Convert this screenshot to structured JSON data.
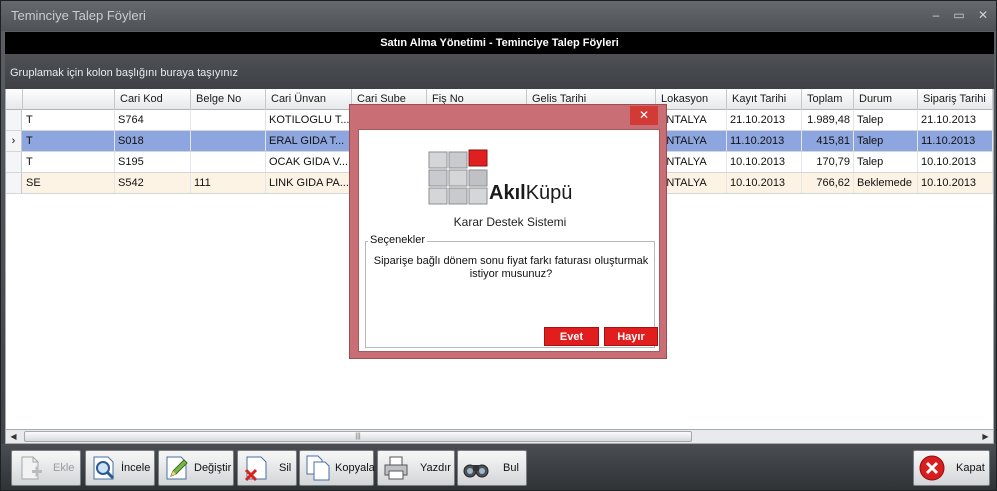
{
  "window": {
    "title": "Teminciye Talep Föyleri",
    "controls": [
      "–",
      "▭",
      "✕"
    ]
  },
  "header": {
    "title": "Satın Alma Yönetimi - Teminciye Talep Föyleri"
  },
  "group_panel": {
    "hint": "Gruplamak için kolon başlığını buraya taşıyınız"
  },
  "grid": {
    "columns": [
      "",
      "Cari Kod",
      "Belge No",
      "Cari Ünvan",
      "Cari Sube",
      "Fiş No",
      "Gelis Tarihi",
      "Lokasyon",
      "Kayıt Tarihi",
      "Toplam",
      "Durum",
      "Sipariş Tarihi"
    ],
    "rows": [
      {
        "indicator": "",
        "type": "T",
        "cari_kod": "S764",
        "belge_no": "",
        "cari_unvan": "KOTILOGLU T...",
        "lokasyon": "ANTALYA",
        "kayit_tarihi": "21.10.2013",
        "toplam": "1.989,48",
        "durum": "Talep",
        "siparis_tarihi": "21.10.2013"
      },
      {
        "indicator": "›",
        "type": "T",
        "cari_kod": "S018",
        "belge_no": "",
        "cari_unvan": "ERAL GIDA T...",
        "lokasyon": "ANTALYA",
        "kayit_tarihi": "11.10.2013",
        "toplam": "415,81",
        "durum": "Talep",
        "siparis_tarihi": "11.10.2013"
      },
      {
        "indicator": "",
        "type": "T",
        "cari_kod": "S195",
        "belge_no": "",
        "cari_unvan": "OCAK GIDA V...",
        "lokasyon": "ANTALYA",
        "kayit_tarihi": "10.10.2013",
        "toplam": "170,79",
        "durum": "Talep",
        "siparis_tarihi": "10.10.2013"
      },
      {
        "indicator": "",
        "type": "SE",
        "cari_kod": "S542",
        "belge_no": "111",
        "cari_unvan": "LINK GIDA PA...",
        "lokasyon": "ANTALYA",
        "kayit_tarihi": "10.10.2013",
        "toplam": "766,62",
        "durum": "Beklemede",
        "siparis_tarihi": "10.10.2013"
      }
    ],
    "selected_row_color": "#8ea6e0",
    "alt_row_color": "#fdf3e5"
  },
  "scrollbar": {
    "left_arrow": "◀",
    "right_arrow": "▶",
    "grip": "|||"
  },
  "toolbar": {
    "ekle": "Ekle",
    "incele": "İncele",
    "degistir": "Değiştir",
    "sil": "Sil",
    "kopyala": "Kopyala",
    "yazdir": "Yazdır",
    "bul": "Bul",
    "kapat": "Kapat"
  },
  "dialog": {
    "close": "✕",
    "logo_bold": "Akıl",
    "logo_light": "Küpü",
    "subtitle": "Karar Destek Sistemi",
    "legend": "Seçenekler",
    "question": "Siparişe bağlı dönem sonu fiyat farkı faturası oluşturmak istiyor musunuz?",
    "yes": "Evet",
    "no": "Hayır",
    "accent_color": "#e21d1d"
  }
}
